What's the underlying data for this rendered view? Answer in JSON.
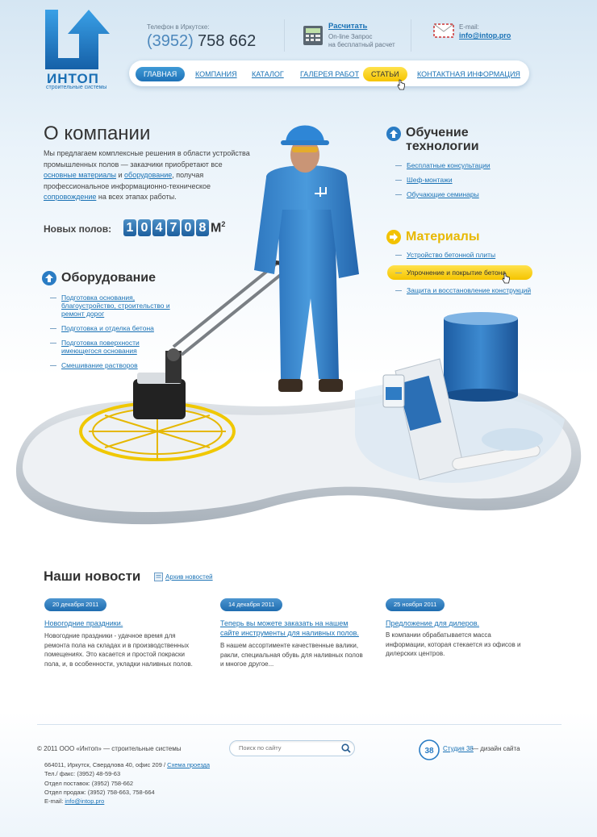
{
  "header": {
    "logo_name": "ИНТОП",
    "logo_sub": "строительные системы",
    "phone_label": "Телефон в Иркутске:",
    "phone_code": "(3952)",
    "phone_number": "758 662",
    "calc_link": "Расчитать",
    "calc_sub_1": "On-line Запрос",
    "calc_sub_2": "на бесплатный расчет",
    "email_label": "E-mail:",
    "email": "info@intop.pro"
  },
  "nav": {
    "items": [
      {
        "label": "Главная",
        "state": "active"
      },
      {
        "label": "Компания",
        "state": ""
      },
      {
        "label": "Каталог",
        "state": ""
      },
      {
        "label": "Галерея работ",
        "state": ""
      },
      {
        "label": "Статьи",
        "state": "hover"
      },
      {
        "label": "Контактная информация",
        "state": ""
      }
    ]
  },
  "about": {
    "title": "О компании",
    "text_1": "Мы предлагаем комплексные решения в области устройства промышленных полов — заказчики приобретают все ",
    "link_materials": "основные материалы",
    "text_2": " и ",
    "link_equipment": "оборудование",
    "text_3": ", получая профессиональное информационно-техническое ",
    "link_support": "сопровождение",
    "text_4": " на всех этапах работы.",
    "floors_label": "Новых полов:",
    "floors_count": "104708",
    "floors_unit": "М",
    "floors_unit_sup": "2"
  },
  "equipment": {
    "title": "Оборудование",
    "items": [
      "Подготовка основания, благоустройство, строительство и ремонт дорог",
      "Подготовка и отделка бетона",
      "Подготовка поверхности имеющегося основания",
      "Смешивание растворов"
    ]
  },
  "training": {
    "title_1": "Обучение",
    "title_2": "технологии",
    "items": [
      "Бесплатные консультации",
      "Шеф-монтажи",
      "Обучающие семинары"
    ]
  },
  "materials": {
    "title": "Материалы",
    "items": [
      "Устройство бетонной плиты",
      "Упрочнение и покрытие бетона",
      "Защита и восстановление конструкций"
    ],
    "highlighted_index": 1
  },
  "news": {
    "title": "Наши новости",
    "archive": "Архив новостей",
    "items": [
      {
        "date": "20 декабря 2011",
        "title": "Новогодние праздники.",
        "text": "Новогодние праздники - удачное время для ремонта пола на складах и в производственных помещениях. Это касается и простой покраски пола, и, в особенности, укладки наливных полов."
      },
      {
        "date": "14 декабря 2011",
        "title": "Теперь вы можете заказать на нашем сайте инструменты для наливных полов.",
        "text": "В нашем ассортименте качественные валики, ракли, специальная обувь для наливных полов и многое другое..."
      },
      {
        "date": "25 ноября 2011",
        "title": "Предложение для дилеров.",
        "text": "В компании обрабатывается масса информации, которая стекается из офисов и дилерских центров."
      }
    ]
  },
  "footer": {
    "copyright": "© 2011 ООО «Интоп» — строительные системы",
    "search_placeholder": "Поиск по сайту",
    "studio_badge": "38",
    "studio_link": "Студия 38",
    "studio_text": " — дизайн сайта",
    "address": "664011, Иркутск, Свердлова 40, офис 209 / ",
    "map_link": "Схема проезда",
    "fax": "Тел./ факс: (3952) 48-59-63",
    "supply": "Отдел поставок: (3952) 758-662",
    "sales": "Отдел продаж: (3952) 758-663, 758-664",
    "email_label": "E-mail: ",
    "email": "info@intop.pro"
  },
  "colors": {
    "brand_blue": "#1a72b5",
    "accent_yellow": "#f5c400"
  }
}
